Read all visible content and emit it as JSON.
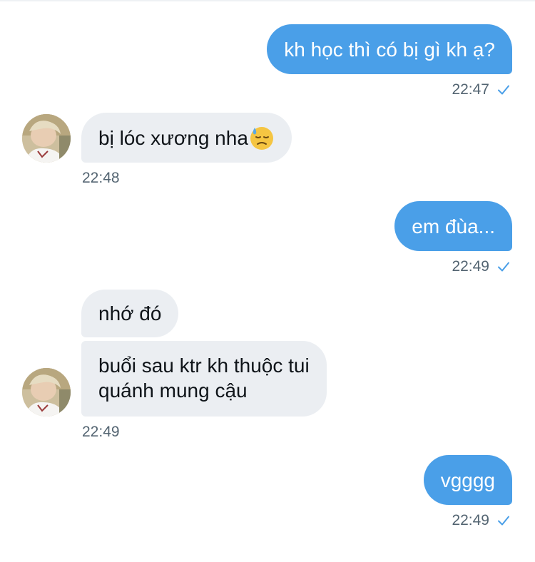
{
  "messages": [
    {
      "text": "kh học thì có bị gì kh ạ?",
      "time": "22:47"
    },
    {
      "text": "bị lóc xương nha",
      "emoji": "downcast-face-with-sweat-icon",
      "time": "22:48"
    },
    {
      "text": "em đùa...",
      "time": "22:49"
    },
    {
      "text": "nhớ đó"
    },
    {
      "line1": "buổi sau ktr kh thuộc tui",
      "line2": "quánh mung cậu",
      "time": "22:49"
    },
    {
      "text": "vgggg",
      "time": "22:49"
    }
  ],
  "colors": {
    "outgoing_bubble": "#4a9fe8",
    "incoming_bubble": "#ebeef2",
    "timestamp": "#536471",
    "read_check": "#4a9fe8"
  }
}
